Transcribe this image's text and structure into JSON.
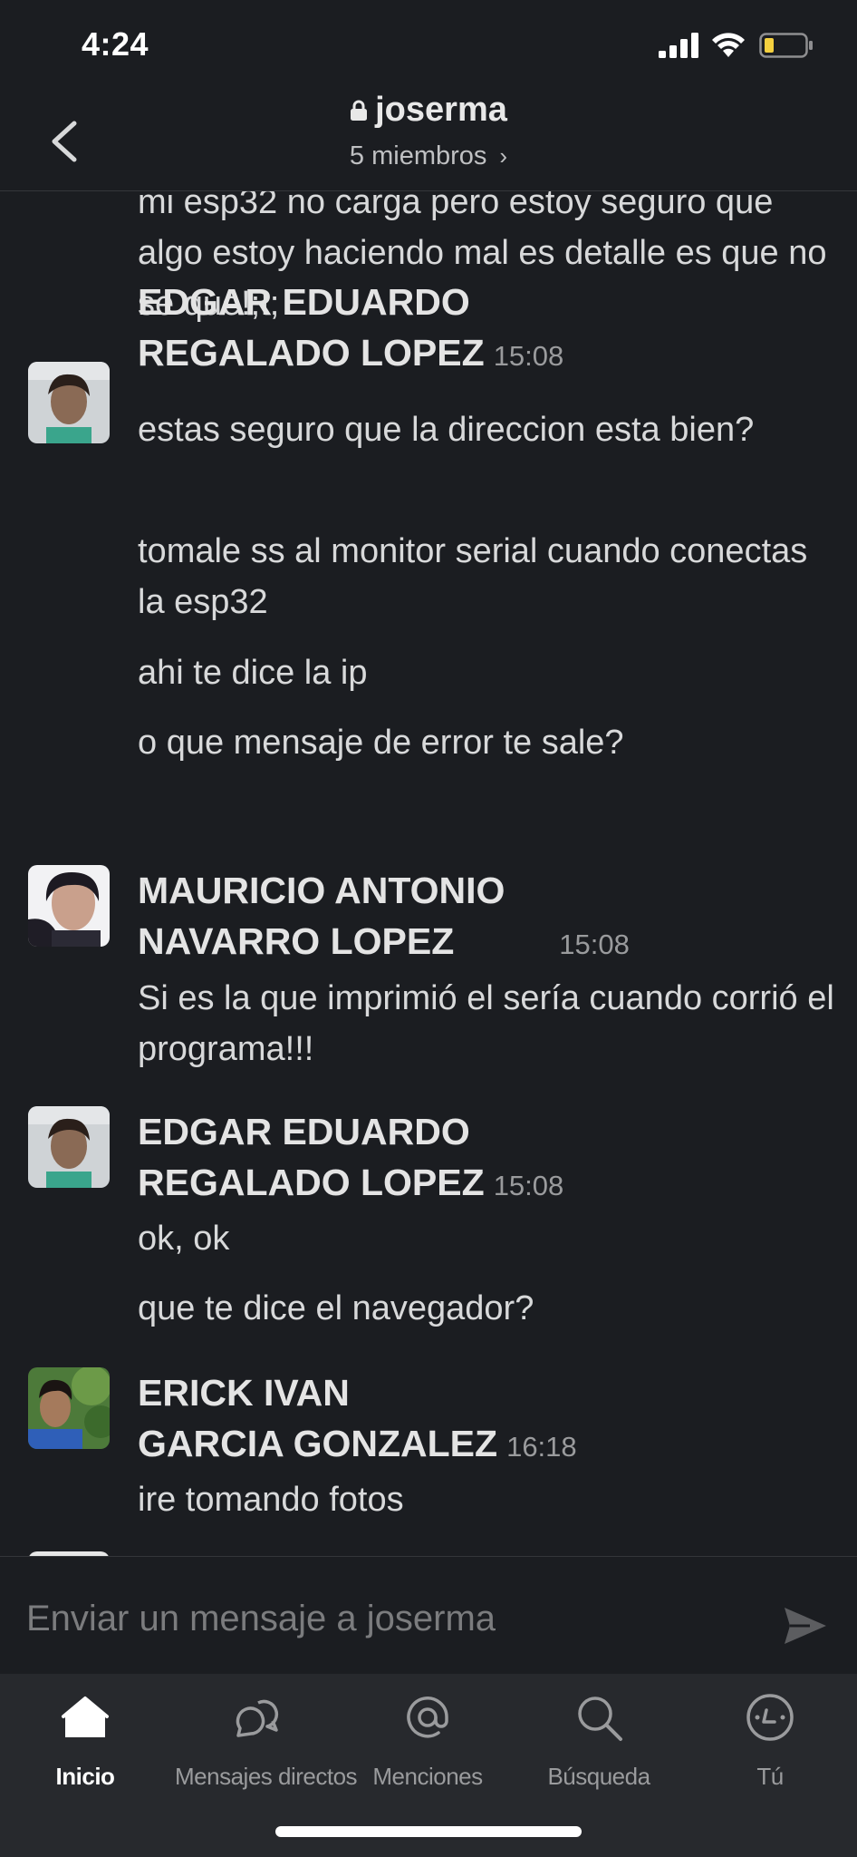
{
  "status_bar": {
    "time": "4:24"
  },
  "header": {
    "channel_name": "joserma",
    "members": "5 miembros"
  },
  "messages": [
    {
      "type": "continuation",
      "text": "mi esp32 no carga pero estoy seguro que algo estoy haciendo mal es detalle es que no se que!;!;"
    },
    {
      "type": "author",
      "name_line1": "EDGAR EDUARDO",
      "name_line2": "REGALADO LOPEZ",
      "time": "15:08"
    },
    {
      "type": "text",
      "text": "estas seguro que la direccion esta bien?"
    },
    {
      "type": "text",
      "text": "tomale ss al monitor serial cuando conectas la esp32"
    },
    {
      "type": "text",
      "text": "ahi te dice la ip"
    },
    {
      "type": "text",
      "text": "o que mensaje de error te sale?"
    },
    {
      "type": "author",
      "name_line1": "MAURICIO ANTONIO",
      "name_line2": "NAVARRO LOPEZ",
      "time": "15:08"
    },
    {
      "type": "text",
      "text": "Si es la que imprimió el sería cuando corrió el programa!!!"
    },
    {
      "type": "author",
      "name_line1": "EDGAR EDUARDO",
      "name_line2": "REGALADO LOPEZ",
      "time": "15:08"
    },
    {
      "type": "text",
      "text": "ok, ok"
    },
    {
      "type": "text",
      "text": "que te dice el navegador?"
    },
    {
      "type": "author",
      "name_line1": "ERICK IVAN",
      "name_line2": "GARCIA GONZALEZ",
      "time": "16:18"
    },
    {
      "type": "text",
      "text": "ire tomando fotos"
    }
  ],
  "composer": {
    "placeholder": "Enviar un mensaje a joserma"
  },
  "tabs": [
    {
      "label": "Inicio",
      "icon": "home-icon",
      "active": true
    },
    {
      "label": "Mensajes directos",
      "icon": "direct-messages-icon",
      "active": false
    },
    {
      "label": "Menciones",
      "icon": "mention-icon",
      "active": false
    },
    {
      "label": "Búsqueda",
      "icon": "search-icon",
      "active": false
    },
    {
      "label": "Tú",
      "icon": "profile-icon",
      "active": false
    }
  ],
  "colors": {
    "background": "#1b1d21",
    "tabbar": "#27292d",
    "text": "#d8d9da",
    "battery_level": "#f4d03f"
  }
}
